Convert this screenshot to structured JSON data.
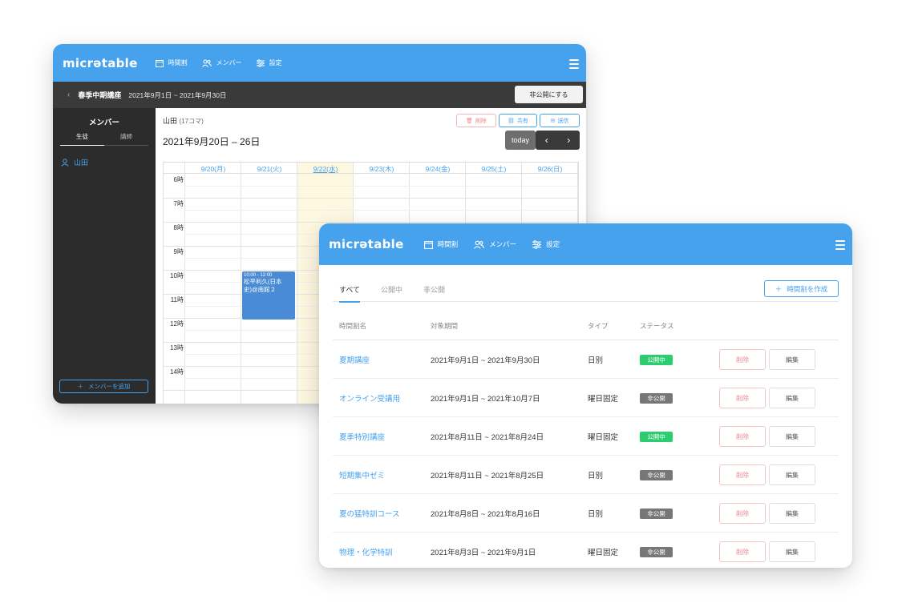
{
  "colors": {
    "brand": "#47a2ee",
    "dark": "#2c2c2c",
    "public": "#2ecc71",
    "private": "#777777",
    "delete": "#ee8888",
    "today_col": "#fff8e1",
    "event": "#4a8bd6"
  },
  "back_window": {
    "logo": "micrətable",
    "nav": [
      {
        "label": "時間割",
        "icon": "calendar-icon"
      },
      {
        "label": "メンバー",
        "icon": "users-icon"
      },
      {
        "label": "設定",
        "icon": "sliders-icon"
      }
    ],
    "subbar": {
      "course": "春季中期講座",
      "range": "2021年9月1日 ~ 2021年9月30日",
      "private_button": "非公開にする"
    },
    "sidebar": {
      "title": "メンバー",
      "tabs": [
        "生徒",
        "講師"
      ],
      "members": [
        "山田"
      ],
      "add_button": "メンバーを追加"
    },
    "main": {
      "user_name": "山田",
      "user_count": "(17コマ)",
      "week_title": "2021年9月20日 – 26日",
      "actions": {
        "delete": "削除",
        "share": "共有",
        "send": "送信"
      },
      "today_button": "today",
      "prev": "‹",
      "next": "›"
    },
    "calendar": {
      "days": [
        "9/20(月)",
        "9/21(火)",
        "9/22(水)",
        "9/23(木)",
        "9/24(金)",
        "9/25(土)",
        "9/26(日)"
      ],
      "today_index": 2,
      "hours": [
        "6時",
        "7時",
        "8時",
        "9時",
        "10時",
        "11時",
        "12時",
        "13時",
        "14時"
      ],
      "event": {
        "time": "10:00 - 12:00",
        "title": "松平利久(日本史)@南館２"
      }
    }
  },
  "front_window": {
    "logo": "micrətable",
    "nav": [
      {
        "label": "時間割",
        "icon": "calendar-icon"
      },
      {
        "label": "メンバー",
        "icon": "users-icon"
      },
      {
        "label": "設定",
        "icon": "sliders-icon"
      }
    ],
    "tabs": [
      "すべて",
      "公開中",
      "非公開"
    ],
    "active_tab": 0,
    "create_button": "時間割を作成",
    "columns": [
      "時間割名",
      "対象期間",
      "タイプ",
      "ステータス"
    ],
    "rows": [
      {
        "name": "夏期講座",
        "period": "2021年9月1日 ~ 2021年9月30日",
        "type": "日別",
        "status": "公開中",
        "public": true
      },
      {
        "name": "オンライン受講用",
        "period": "2021年9月1日 ~ 2021年10月7日",
        "type": "曜日固定",
        "status": "非公開",
        "public": false
      },
      {
        "name": "夏季特別講座",
        "period": "2021年8月11日 ~ 2021年8月24日",
        "type": "曜日固定",
        "status": "公開中",
        "public": true
      },
      {
        "name": "短期集中ゼミ",
        "period": "2021年8月11日 ~ 2021年8月25日",
        "type": "日別",
        "status": "非公開",
        "public": false
      },
      {
        "name": "夏の猛特訓コース",
        "period": "2021年8月8日 ~ 2021年8月16日",
        "type": "日別",
        "status": "非公開",
        "public": false
      },
      {
        "name": "物理・化学特訓",
        "period": "2021年8月3日 ~ 2021年9月1日",
        "type": "曜日固定",
        "status": "非公開",
        "public": false
      }
    ],
    "row_actions": {
      "delete": "削除",
      "edit": "編集"
    }
  }
}
